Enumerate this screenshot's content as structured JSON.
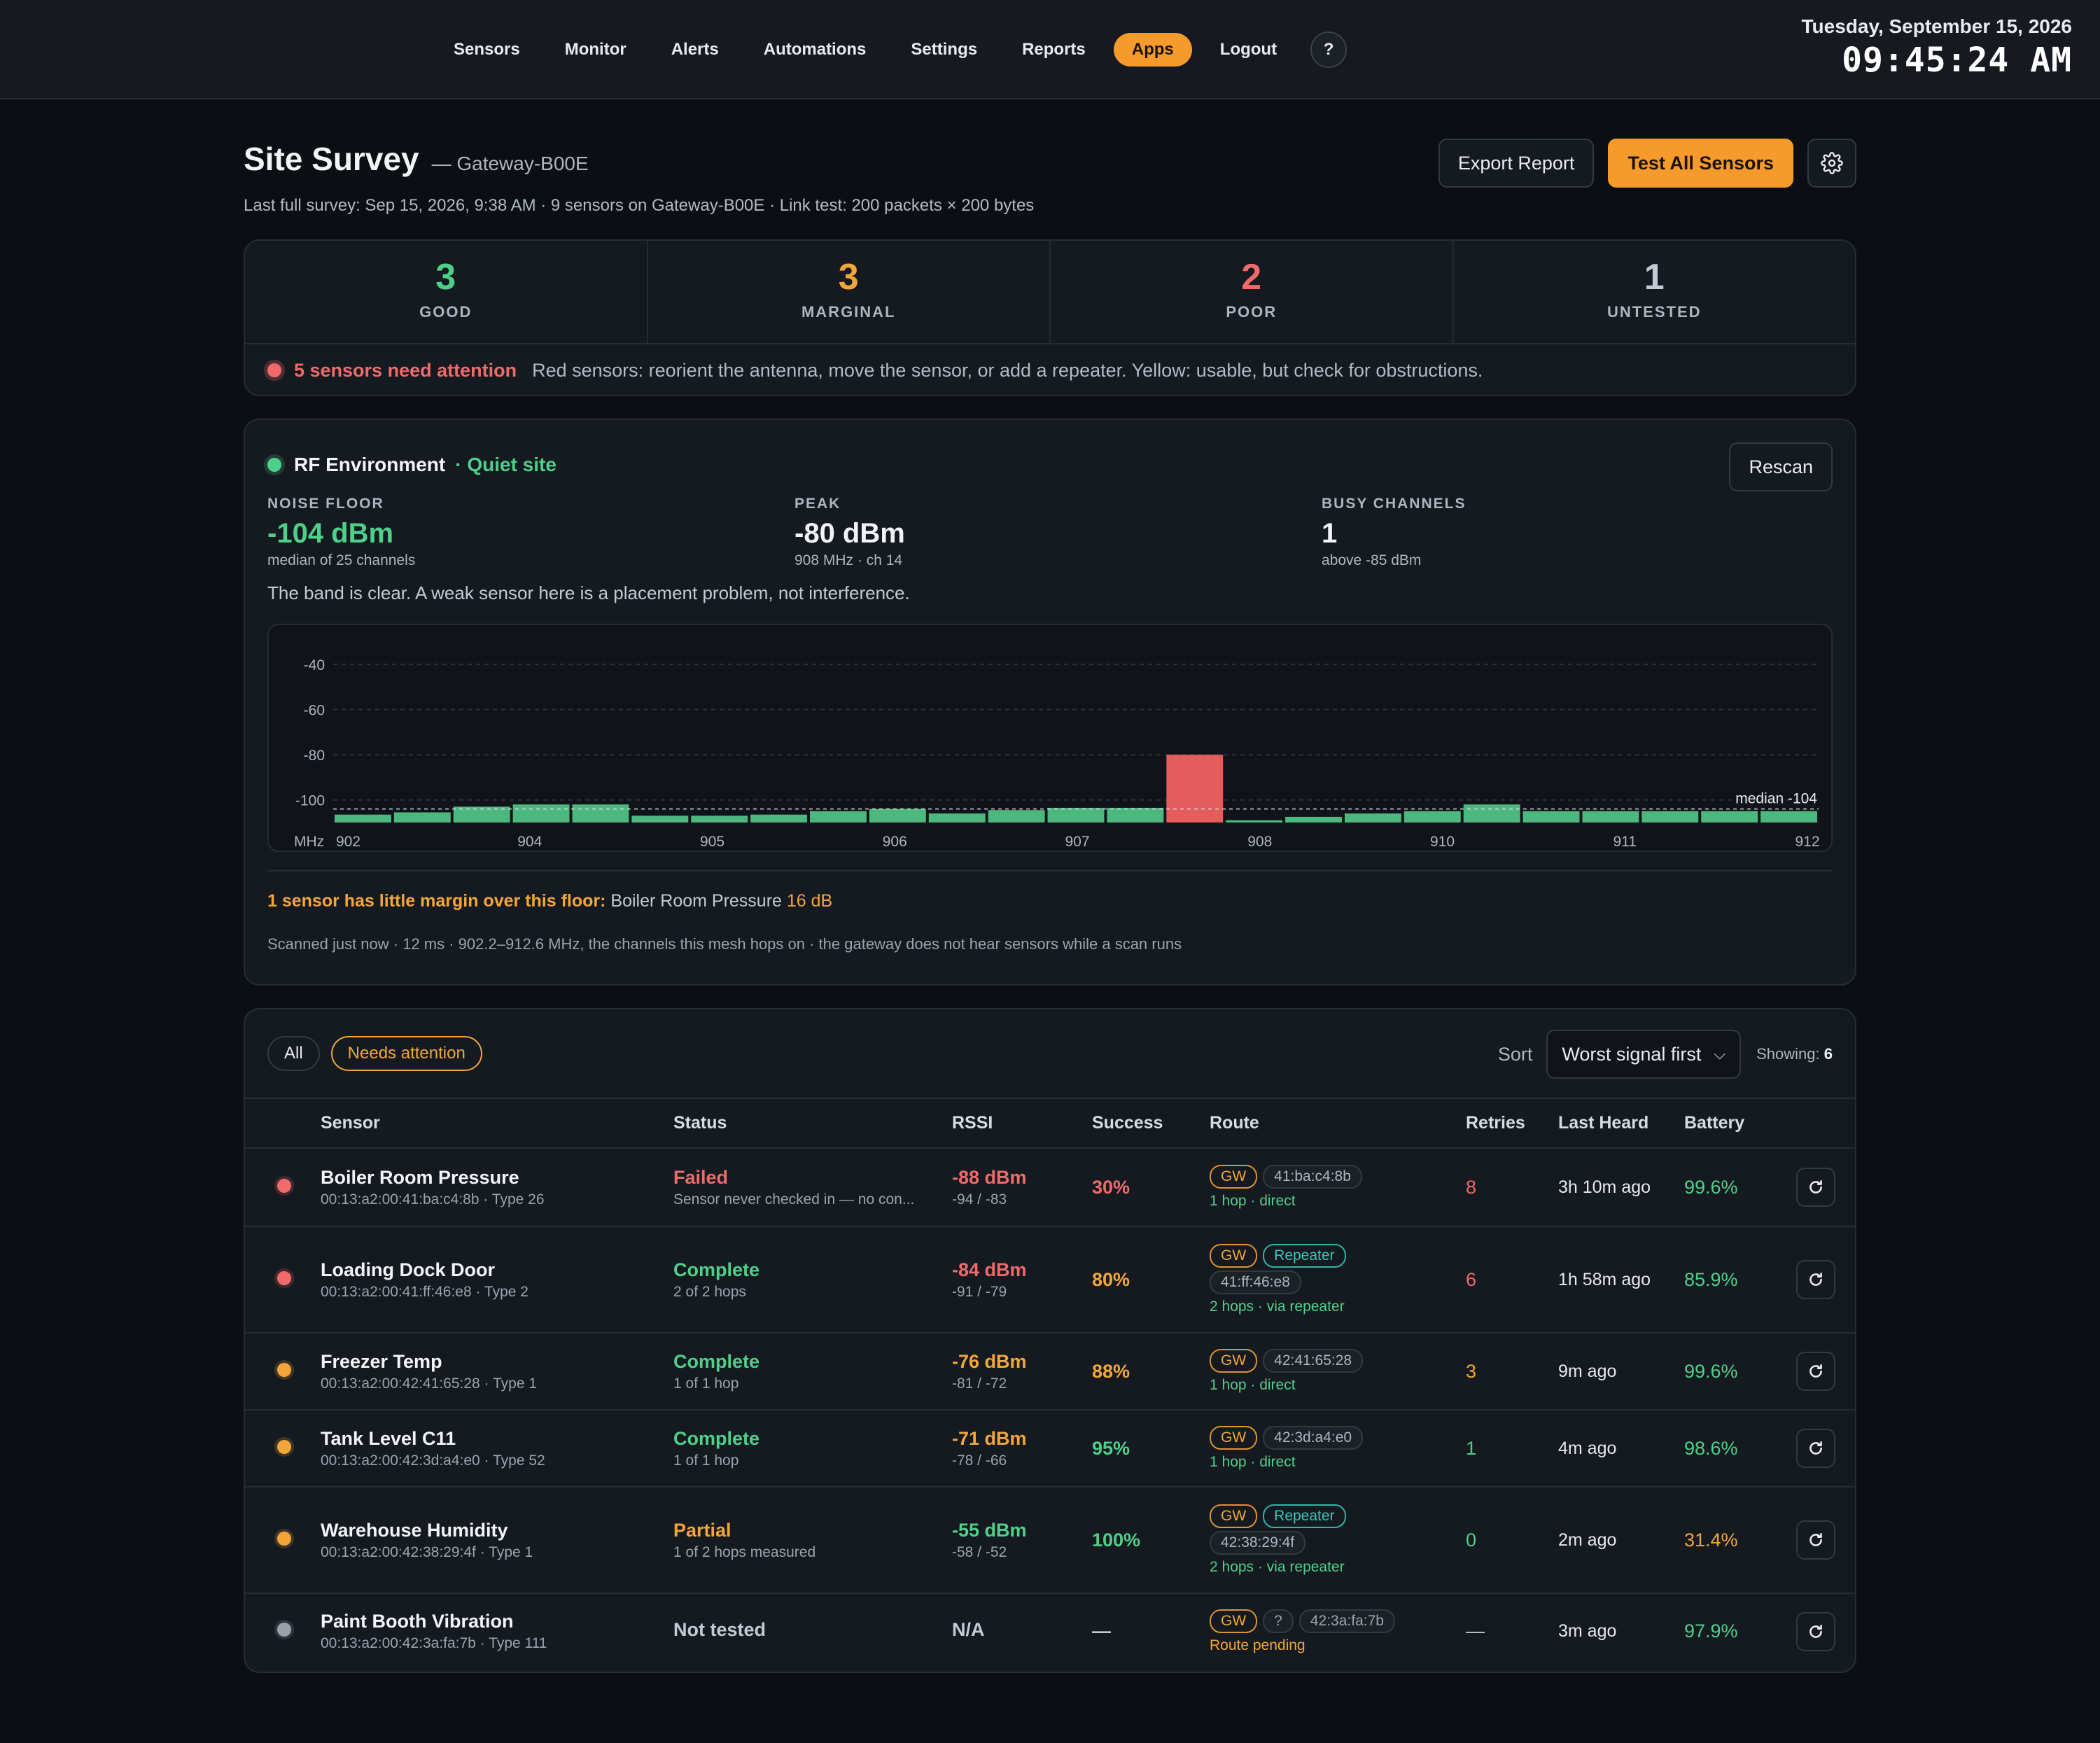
{
  "nav": {
    "items": [
      "Sensors",
      "Monitor",
      "Alerts",
      "Automations",
      "Settings",
      "Reports",
      "Apps",
      "Logout"
    ],
    "active": "Apps",
    "help": "?"
  },
  "clock": {
    "date": "Tuesday, September 15, 2026",
    "time": "09:45:24 AM"
  },
  "page": {
    "title": "Site Survey",
    "subtitle": "— Gateway-B00E",
    "meta": "Last full survey: Sep 15, 2026, 9:38 AM · 9 sensors on Gateway-B00E · Link test: 200 packets × 200 bytes",
    "export_label": "Export Report",
    "test_all_label": "Test All Sensors",
    "settings_icon": "gear-icon"
  },
  "summary": {
    "stats": [
      {
        "value": "3",
        "label": "GOOD",
        "color": "#4fd08a"
      },
      {
        "value": "3",
        "label": "MARGINAL",
        "color": "#f2a63a"
      },
      {
        "value": "2",
        "label": "POOR",
        "color": "#f06a6a"
      },
      {
        "value": "1",
        "label": "UNTESTED",
        "color": "#c4cad3"
      }
    ],
    "attention_title": "5 sensors need attention",
    "attention_text": "Red sensors: reorient the antenna, move the sensor, or add a repeater. Yellow: usable, but check for obstructions."
  },
  "rf": {
    "title": "RF Environment",
    "tag": "· Quiet site",
    "rescan_label": "Rescan",
    "metrics": [
      {
        "label": "NOISE FLOOR",
        "value": "-104 dBm",
        "note": "median of 25 channels",
        "color": "#4fd08a"
      },
      {
        "label": "PEAK",
        "value": "-80 dBm",
        "note": "908 MHz · ch 14",
        "color": "#f2f4f7"
      },
      {
        "label": "BUSY CHANNELS",
        "value": "1",
        "note": "above -85 dBm",
        "color": "#f2f4f7"
      }
    ],
    "verdict": "The band is clear. A weak sensor here is a placement problem, not interference.",
    "margin_warn": "1 sensor has little margin over this floor:",
    "margin_sensor": "Boiler Room Pressure",
    "margin_value": "16 dB",
    "footer": "Scanned just now · 12 ms · 902.2–912.6 MHz, the channels this mesh hops on · the gateway does not hear sensors while a scan runs"
  },
  "chart_data": {
    "type": "bar",
    "xlabel": "MHz",
    "x_ticks": [
      "902",
      "904",
      "905",
      "906",
      "907",
      "908",
      "910",
      "911",
      "912"
    ],
    "y_ticks": [
      -40,
      -60,
      -80,
      -100
    ],
    "ylim": [
      -110,
      -35
    ],
    "median_label": "median -104",
    "median": -104,
    "values": [
      -106.5,
      -105.5,
      -103,
      -102,
      -102,
      -107,
      -107,
      -106.5,
      -105,
      -104,
      -106,
      -104.5,
      -103.5,
      -103.5,
      -80,
      -109,
      -107.5,
      -106,
      -105,
      -102,
      -105,
      -105,
      -105,
      -105,
      -105
    ],
    "busy_index": 14,
    "colors": {
      "normal": "#4cb87d",
      "busy": "#e45c5c"
    }
  },
  "table": {
    "filters": [
      "All",
      "Needs attention"
    ],
    "active_filter": "Needs attention",
    "sort_label": "Sort",
    "sort_value": "Worst signal first",
    "showing_label": "Showing:",
    "showing_count": "6",
    "columns": [
      "Sensor",
      "Status",
      "RSSI",
      "Success",
      "Route",
      "Retries",
      "Last Heard",
      "Battery"
    ],
    "rows": [
      {
        "dot": "#f06a6a",
        "name": "Boiler Room Pressure",
        "id": "00:13:a2:00:41:ba:c4:8b · Type 26",
        "status": "Failed",
        "status_color": "#f06a6a",
        "status_sub": "Sensor never checked in — no con...",
        "rssi": "-88 dBm",
        "rssi_color": "#f06a6a",
        "rssi_sub": "-94 / -83",
        "success": "30%",
        "success_color": "#f06a6a",
        "route": {
          "gw": "GW",
          "repeater": "",
          "unknown": "",
          "mac": "41:ba:c4:8b",
          "note": "1 hop · direct",
          "pending": false
        },
        "retries": "8",
        "retries_color": "#f06a6a",
        "last_heard": "3h 10m ago",
        "battery": "99.6%",
        "battery_color": "#4fd08a"
      },
      {
        "dot": "#f06a6a",
        "name": "Loading Dock Door",
        "id": "00:13:a2:00:41:ff:46:e8 · Type 2",
        "status": "Complete",
        "status_color": "#4fd08a",
        "status_sub": "2 of 2 hops",
        "rssi": "-84 dBm",
        "rssi_color": "#f06a6a",
        "rssi_sub": "-91 / -79",
        "success": "80%",
        "success_color": "#f2a63a",
        "route": {
          "gw": "GW",
          "repeater": "Repeater",
          "unknown": "",
          "mac": "41:ff:46:e8",
          "note": "2 hops · via repeater",
          "pending": false
        },
        "retries": "6",
        "retries_color": "#f06a6a",
        "last_heard": "1h 58m ago",
        "battery": "85.9%",
        "battery_color": "#4fd08a"
      },
      {
        "dot": "#f2a63a",
        "name": "Freezer Temp",
        "id": "00:13:a2:00:42:41:65:28 · Type 1",
        "status": "Complete",
        "status_color": "#4fd08a",
        "status_sub": "1 of 1 hop",
        "rssi": "-76 dBm",
        "rssi_color": "#f2a63a",
        "rssi_sub": "-81 / -72",
        "success": "88%",
        "success_color": "#f2a63a",
        "route": {
          "gw": "GW",
          "repeater": "",
          "unknown": "",
          "mac": "42:41:65:28",
          "note": "1 hop · direct",
          "pending": false
        },
        "retries": "3",
        "retries_color": "#f2a63a",
        "last_heard": "9m ago",
        "battery": "99.6%",
        "battery_color": "#4fd08a"
      },
      {
        "dot": "#f2a63a",
        "name": "Tank Level C11",
        "id": "00:13:a2:00:42:3d:a4:e0 · Type 52",
        "status": "Complete",
        "status_color": "#4fd08a",
        "status_sub": "1 of 1 hop",
        "rssi": "-71 dBm",
        "rssi_color": "#f2a63a",
        "rssi_sub": "-78 / -66",
        "success": "95%",
        "success_color": "#4fd08a",
        "route": {
          "gw": "GW",
          "repeater": "",
          "unknown": "",
          "mac": "42:3d:a4:e0",
          "note": "1 hop · direct",
          "pending": false
        },
        "retries": "1",
        "retries_color": "#4fd08a",
        "last_heard": "4m ago",
        "battery": "98.6%",
        "battery_color": "#4fd08a"
      },
      {
        "dot": "#f2a63a",
        "name": "Warehouse Humidity",
        "id": "00:13:a2:00:42:38:29:4f · Type 1",
        "status": "Partial",
        "status_color": "#f2a63a",
        "status_sub": "1 of 2 hops measured",
        "rssi": "-55 dBm",
        "rssi_color": "#4fd08a",
        "rssi_sub": "-58 / -52",
        "success": "100%",
        "success_color": "#4fd08a",
        "route": {
          "gw": "GW",
          "repeater": "Repeater",
          "unknown": "",
          "mac": "42:38:29:4f",
          "note": "2 hops · via repeater",
          "pending": false
        },
        "retries": "0",
        "retries_color": "#4fd08a",
        "last_heard": "2m ago",
        "battery": "31.4%",
        "battery_color": "#f2a63a"
      },
      {
        "dot": "#9aa1ab",
        "name": "Paint Booth Vibration",
        "id": "00:13:a2:00:42:3a:fa:7b · Type 111",
        "status": "Not tested",
        "status_color": "#c4cad3",
        "status_sub": "",
        "rssi": "N/A",
        "rssi_color": "#c4cad3",
        "rssi_sub": "",
        "success": "—",
        "success_color": "#c4cad3",
        "route": {
          "gw": "GW",
          "repeater": "",
          "unknown": "?",
          "mac": "42:3a:fa:7b",
          "note": "Route pending",
          "pending": true
        },
        "retries": "—",
        "retries_color": "#c4cad3",
        "last_heard": "3m ago",
        "battery": "97.9%",
        "battery_color": "#4fd08a"
      }
    ]
  }
}
